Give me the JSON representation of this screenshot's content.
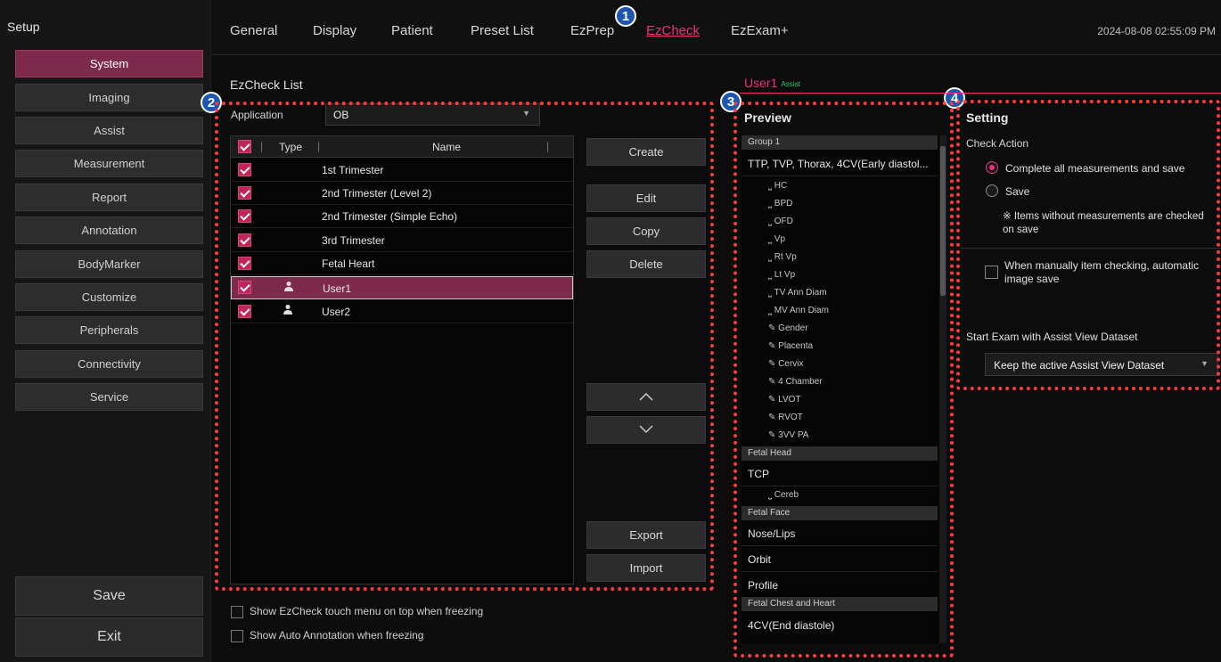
{
  "sidebar": {
    "title": "Setup",
    "items": [
      {
        "label": "System",
        "active": true
      },
      {
        "label": "Imaging"
      },
      {
        "label": "Assist"
      },
      {
        "label": "Measurement"
      },
      {
        "label": "Report"
      },
      {
        "label": "Annotation"
      },
      {
        "label": "BodyMarker"
      },
      {
        "label": "Customize"
      },
      {
        "label": "Peripherals"
      },
      {
        "label": "Connectivity"
      },
      {
        "label": "Service"
      }
    ],
    "save_label": "Save",
    "exit_label": "Exit"
  },
  "tabs": [
    {
      "label": "General"
    },
    {
      "label": "Display"
    },
    {
      "label": "Patient"
    },
    {
      "label": "Preset List"
    },
    {
      "label": "EzPrep"
    },
    {
      "label": "EzCheck",
      "active": true
    },
    {
      "label": "EzExam+"
    }
  ],
  "datetime": "2024-08-08 02:55:09 PM",
  "badges": [
    "1",
    "2",
    "3",
    "4"
  ],
  "ezcheck": {
    "title": "EzCheck List",
    "application_label": "Application",
    "application_value": "OB",
    "header": {
      "type": "Type",
      "name": "Name"
    },
    "rows": [
      {
        "name": "1st Trimester",
        "user": false
      },
      {
        "name": "2nd Trimester (Level 2)",
        "user": false
      },
      {
        "name": "2nd Trimester (Simple Echo)",
        "user": false
      },
      {
        "name": "3rd Trimester",
        "user": false
      },
      {
        "name": "Fetal Heart",
        "user": false
      },
      {
        "name": "User1",
        "user": true,
        "selected": true
      },
      {
        "name": "User2",
        "user": true
      }
    ],
    "buttons": {
      "create": "Create",
      "edit": "Edit",
      "copy": "Copy",
      "delete": "Delete",
      "up": "︿",
      "down": "﹀",
      "export": "Export",
      "import": "Import"
    },
    "options": [
      "Show EzCheck touch menu on top when freezing",
      "Show Auto Annotation when freezing"
    ]
  },
  "preview": {
    "user_title": "User1",
    "assist_tag": "Assist",
    "title": "Preview",
    "group1": "Group 1",
    "main1": "TTP, TVP, Thorax, 4CV(Early diastol...",
    "subs1": [
      "HC",
      "BPD",
      "OFD",
      "Vp",
      "Rt Vp",
      "Lt Vp",
      "TV Ann Diam",
      "MV Ann Diam",
      "Gender",
      "Placenta",
      "Cervix",
      "4 Chamber",
      "LVOT",
      "RVOT",
      "3VV PA"
    ],
    "group2": "Fetal Head",
    "main2": "TCP",
    "subs2": [
      "Cereb"
    ],
    "group3": "Fetal Face",
    "face_items": [
      "Nose/Lips",
      "Orbit",
      "Profile"
    ],
    "group4": "Fetal Chest and Heart",
    "main4": "4CV(End diastole)"
  },
  "setting": {
    "title": "Setting",
    "check_action": "Check Action",
    "radio1": "Complete all measurements and save",
    "radio2": "Save",
    "note": "※ Items without measurements are checked on save",
    "auto_image": "When manually item checking, automatic image save",
    "start_label": "Start Exam with Assist View Dataset",
    "dataset_value": "Keep the active Assist View Dataset"
  },
  "colors": {
    "accent": "#e9337a",
    "active": "#7d2a4c",
    "badge": "#1d55b0",
    "dotted": "#ff3a3a"
  }
}
